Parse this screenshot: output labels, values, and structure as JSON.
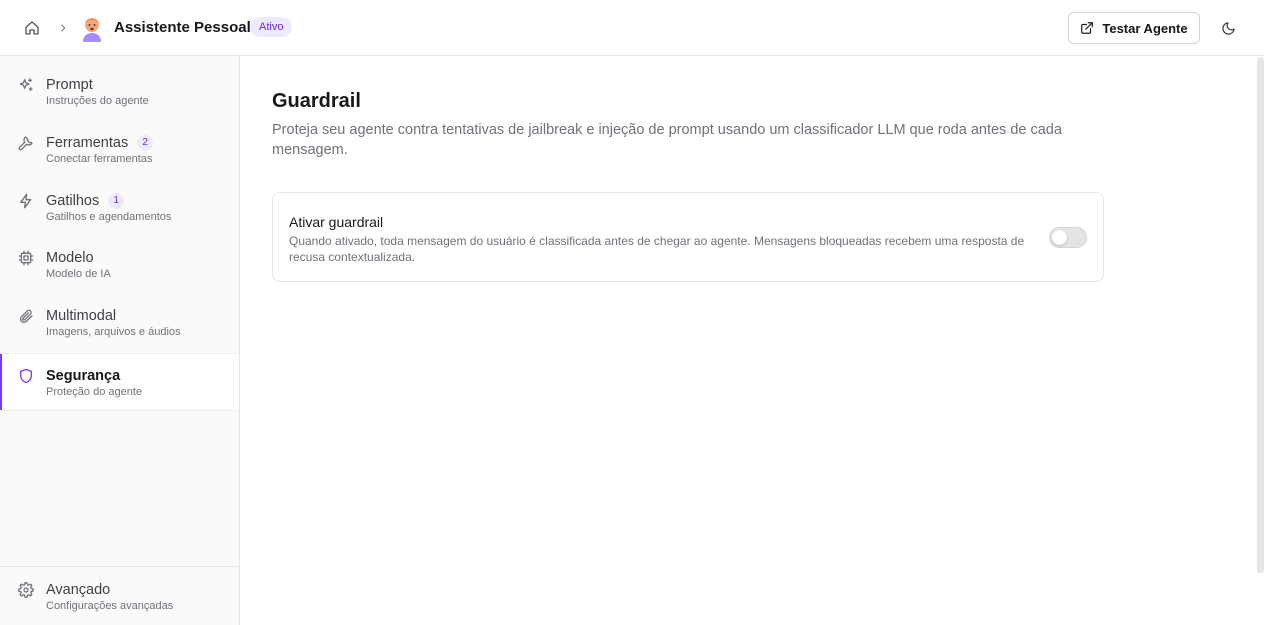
{
  "header": {
    "agent_name": "Assistente Pessoal",
    "status": "Ativo",
    "test_button_label": "Testar Agente"
  },
  "sidebar": {
    "items": [
      {
        "title": "Prompt",
        "subtitle": "Instruções do agente",
        "icon": "sparkles-icon"
      },
      {
        "title": "Ferramentas",
        "subtitle": "Conectar ferramentas",
        "count": "2",
        "icon": "wrench-icon"
      },
      {
        "title": "Gatilhos",
        "subtitle": "Gatilhos e agendamentos",
        "count": "1",
        "icon": "zap-icon"
      },
      {
        "title": "Modelo",
        "subtitle": "Modelo de IA",
        "icon": "cpu-icon"
      },
      {
        "title": "Multimodal",
        "subtitle": "Imagens, arquivos e áudios",
        "icon": "paperclip-icon"
      },
      {
        "title": "Segurança",
        "subtitle": "Proteção do agente",
        "icon": "shield-icon",
        "active": true
      }
    ],
    "footer": {
      "title": "Avançado",
      "subtitle": "Configurações avançadas",
      "icon": "gear-icon"
    }
  },
  "main": {
    "title": "Guardrail",
    "description": "Proteja seu agente contra tentativas de jailbreak e injeção de prompt usando um classificador LLM que roda antes de cada mensagem.",
    "guardrail": {
      "title": "Ativar guardrail",
      "description": "Quando ativado, toda mensagem do usuário é classificada antes de chegar ao agente. Mensagens bloqueadas recebem uma resposta de recusa contextualizada.",
      "enabled": false
    }
  },
  "colors": {
    "accent": "#7c3aed",
    "badge_bg": "#ede9fe",
    "muted_text": "#71717a",
    "border": "#e4e4e7"
  }
}
